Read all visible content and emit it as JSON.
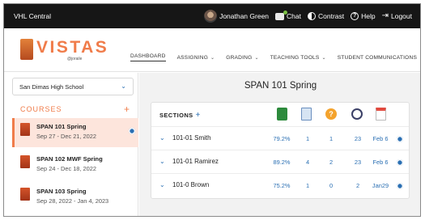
{
  "topbar": {
    "brand": "VHL Central",
    "user_name": "Jonathan Green",
    "chat_label": "Chat",
    "contrast_label": "Contrast",
    "help_label": "Help",
    "logout_label": "Logout"
  },
  "logo": {
    "text": "VISTAS",
    "subtext": "@joraile"
  },
  "nav": [
    {
      "label": "DASHBOARD"
    },
    {
      "label": "ASSIGNING"
    },
    {
      "label": "GRADING"
    },
    {
      "label": "TEACHING TOOLS"
    },
    {
      "label": "STUDENT COMMUNICATIONS"
    }
  ],
  "sidebar": {
    "school": "San Dimas High School",
    "courses_heading": "COURSES",
    "courses": [
      {
        "name": "SPAN 101 Spring",
        "dates": "Sep 27 - Dec 21, 2022",
        "selected": true
      },
      {
        "name": "SPAN 102 MWF Spring",
        "dates": "Sep 24 - Dec 18, 2022",
        "selected": false
      },
      {
        "name": "SPAN 103 Spring",
        "dates": "Sep 28, 2022 - Jan 4, 2023",
        "selected": false
      }
    ]
  },
  "main": {
    "title": "SPAN 101 Spring",
    "sections_label": "SECTIONS",
    "header_icons": [
      "gradebook-icon",
      "grading-icon",
      "question-icon",
      "students-icon",
      "calendar-icon"
    ],
    "sections": [
      {
        "name": "101-01 Smith",
        "percent": "79.2%",
        "to_grade": "1",
        "questions": "1",
        "students": "23",
        "due": "Feb 6"
      },
      {
        "name": "101-01 Ramirez",
        "percent": "89.2%",
        "to_grade": "4",
        "questions": "2",
        "students": "23",
        "due": "Feb 6"
      },
      {
        "name": "101-0 Brown",
        "percent": "75.2%",
        "to_grade": "1",
        "questions": "0",
        "students": "2",
        "due": "Jan29"
      }
    ]
  },
  "colors": {
    "accent": "#f07c4a",
    "link": "#2a6fb3",
    "topbar": "#161616"
  }
}
